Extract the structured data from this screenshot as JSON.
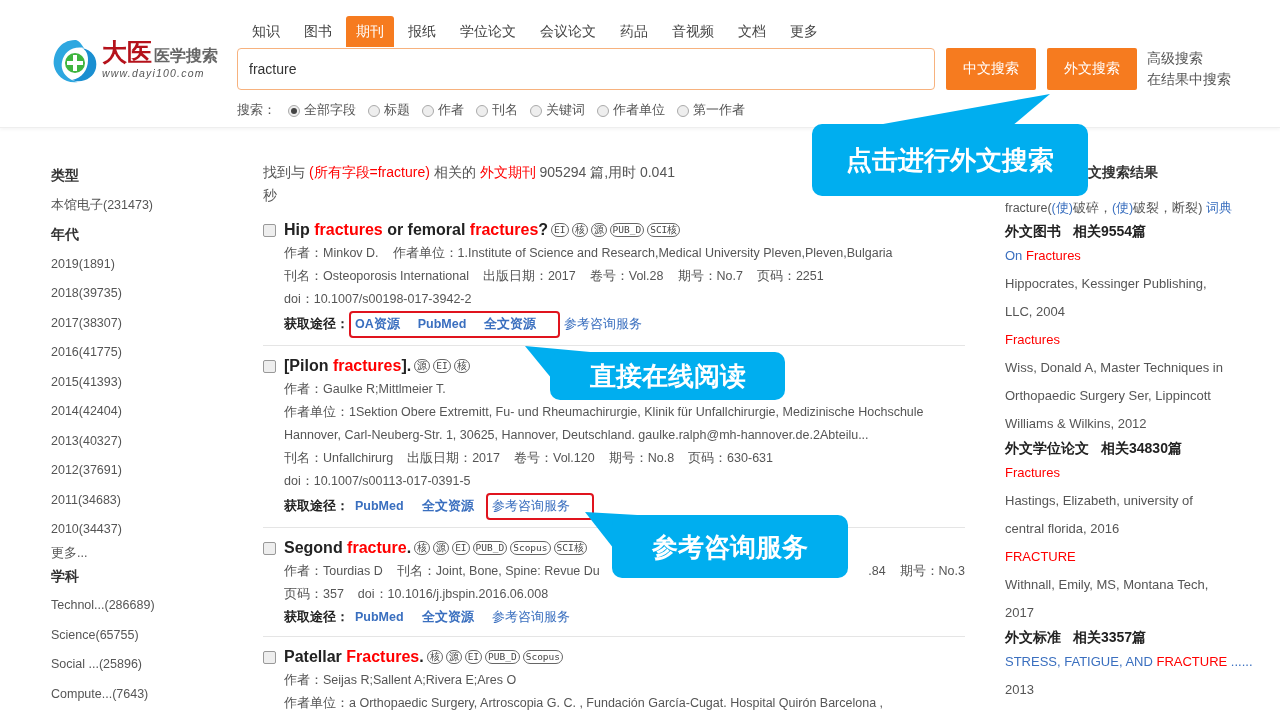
{
  "logo": {
    "brand": "大医",
    "subtitle": "医学搜索",
    "url": "www.dayi100.com"
  },
  "tabs": [
    {
      "label": "知识",
      "selected": false
    },
    {
      "label": "图书",
      "selected": false
    },
    {
      "label": "期刊",
      "selected": true
    },
    {
      "label": "报纸",
      "selected": false
    },
    {
      "label": "学位论文",
      "selected": false
    },
    {
      "label": "会议论文",
      "selected": false
    },
    {
      "label": "药品",
      "selected": false
    },
    {
      "label": "音视频",
      "selected": false
    },
    {
      "label": "文档",
      "selected": false
    },
    {
      "label": "更多",
      "selected": false
    }
  ],
  "search": {
    "value": "fracture",
    "buttons": [
      "中文搜索",
      "外文搜索"
    ],
    "links": [
      "高级搜索",
      "在结果中搜索"
    ]
  },
  "scope": {
    "label": "搜索：",
    "options": [
      {
        "label": "全部字段",
        "selected": true
      },
      {
        "label": "标题",
        "selected": false
      },
      {
        "label": "作者",
        "selected": false
      },
      {
        "label": "刊名",
        "selected": false
      },
      {
        "label": "关键词",
        "selected": false
      },
      {
        "label": "作者单位",
        "selected": false
      },
      {
        "label": "第一作者",
        "selected": false
      }
    ]
  },
  "sidebar": {
    "groups": [
      {
        "heading": "类型",
        "items": [
          "本馆电子(231473)"
        ]
      },
      {
        "heading": "年代",
        "items": [
          "2019(1891)",
          "2018(39735)",
          "2017(38307)",
          "2016(41775)",
          "2015(41393)",
          "2014(42404)",
          "2013(40327)",
          "2012(37691)",
          "2011(34683)",
          "2010(34437)"
        ],
        "more": "更多..."
      },
      {
        "heading": "学科",
        "items": [
          "Technol...(286689)",
          "Science(65755)",
          "Social ...(25896)",
          "Compute...(7643)"
        ]
      }
    ]
  },
  "summary": [
    {
      "text": "找到与 "
    },
    {
      "text": "(所有字段=fracture)",
      "hit": true
    },
    {
      "text": " 相关的 "
    },
    {
      "text": "外文期刊",
      "hit": true
    },
    {
      "text": " 905294 篇,用时 0.041 秒"
    }
  ],
  "results": [
    {
      "checked": false,
      "title": [
        {
          "text": "Hip "
        },
        {
          "text": "fractures",
          "hit": true
        },
        {
          "text": " or femoral "
        },
        {
          "text": "fractures",
          "hit": true
        },
        {
          "text": "?"
        }
      ],
      "tags": [
        "EI",
        "核",
        "源",
        "PUB_D",
        "SCI核"
      ],
      "lines": [
        {
          "fields": [
            "作者：Minkov D.",
            "作者单位：1.Institute of Science and Research,Medical University Pleven,Pleven,Bulgaria"
          ]
        },
        {
          "fields": [
            "刊名：Osteoporosis International",
            "出版日期：2017",
            "卷号：Vol.28",
            "期号：No.7",
            "页码：2251"
          ]
        },
        {
          "fields": [
            "doi：10.1007/s00198-017-3942-2"
          ]
        }
      ],
      "access_label": "获取途径：",
      "links": [
        {
          "text": "OA资源",
          "bold": true,
          "outlined": true
        },
        {
          "text": "PubMed",
          "bold": true,
          "outlined": true
        },
        {
          "text": "全文资源",
          "bold": true,
          "outlined": true
        },
        {
          "text": "参考咨询服务",
          "bold": false,
          "outlined": false
        }
      ]
    },
    {
      "checked": false,
      "title": [
        {
          "text": "[Pilon "
        },
        {
          "text": "fractures",
          "hit": true
        },
        {
          "text": "]."
        }
      ],
      "tags": [
        "源",
        "EI",
        "核"
      ],
      "lines": [
        {
          "fields": [
            "作者：Gaulke R;Mittlmeier T."
          ]
        },
        {
          "fields": [
            "作者单位：1Sektion Obere Extremitt, Fu- und Rheumachirurgie, Klinik für Unfallchirurgie, Medizinische Hochschule Hannover, Carl-Neuberg-Str. 1, 30625, Hannover, Deutschland. gaulke.ralph@mh-hannover.de.2Abteilu..."
          ]
        },
        {
          "fields": [
            "刊名：Unfallchirurg",
            "出版日期：2017",
            "卷号：Vol.120",
            "期号：No.8",
            "页码：630-631"
          ]
        },
        {
          "fields": [
            "doi：10.1007/s00113-017-0391-5"
          ]
        }
      ],
      "access_label": "获取途径：",
      "links": [
        {
          "text": "PubMed",
          "bold": true,
          "outlined": false
        },
        {
          "text": "全文资源",
          "bold": true,
          "outlined": false
        },
        {
          "text": "参考咨询服务",
          "bold": false,
          "outlined": true
        }
      ]
    },
    {
      "checked": false,
      "title": [
        {
          "text": "Segond "
        },
        {
          "text": "fracture",
          "hit": true
        },
        {
          "text": "."
        }
      ],
      "tags": [
        "核",
        "源",
        "EI",
        "PUB_D",
        "Scopus",
        "SCI核"
      ],
      "lines": [
        {
          "fields": [
            "作者：Tourdias D",
            "刊名：Joint, Bone, Spine: Revue Du"
          ],
          "right": [
            ".84",
            "期号：No.3"
          ]
        },
        {
          "fields": [
            "页码：357",
            "doi：10.1016/j.jbspin.2016.06.008"
          ]
        }
      ],
      "access_label": "获取途径：",
      "links": [
        {
          "text": "PubMed",
          "bold": true,
          "outlined": false
        },
        {
          "text": "全文资源",
          "bold": true,
          "outlined": false
        },
        {
          "text": "参考咨询服务",
          "bold": false,
          "outlined": false
        }
      ]
    },
    {
      "checked": false,
      "title": [
        {
          "text": "Patellar "
        },
        {
          "text": "Fractures",
          "hit": true
        },
        {
          "text": "."
        }
      ],
      "tags": [
        "核",
        "源",
        "EI",
        "PUB_D",
        "Scopus"
      ],
      "lines": [
        {
          "fields": [
            "作者：Seijas R;Sallent A;Rivera E;Ares O"
          ]
        },
        {
          "fields": [
            "作者单位：a Orthopaedic Surgery, Artroscopia G. C. , Fundación García-Cugat. Hospital Quirón Barcelona ,"
          ]
        }
      ]
    }
  ],
  "related": {
    "heading": "文搜索结果",
    "dictionary": [
      {
        "text": "fracture(",
        "link": false
      },
      {
        "text": "(使)",
        "link": true
      },
      {
        "text": "破碎，",
        "link": false
      },
      {
        "text": "(使)",
        "link": true
      },
      {
        "text": "破裂，断裂)",
        "link": false
      },
      {
        "text": " 词典",
        "link": true
      }
    ],
    "sections": [
      {
        "heading": "外文图书",
        "count": "相关9554篇",
        "items": [
          {
            "title": [
              {
                "text": "On "
              },
              {
                "text": "Fractures",
                "hit": true
              }
            ],
            "description": "Hippocrates, Kessinger Publishing, LLC, 2004"
          },
          {
            "title": [
              {
                "text": "Fractures",
                "hit": true
              }
            ],
            "description": "Wiss, Donald A, Master Techniques in Orthopaedic Surgery Ser, Lippincott Williams & Wilkins, 2012"
          }
        ]
      },
      {
        "heading": "外文学位论文",
        "count": "相关34830篇",
        "items": [
          {
            "title": [
              {
                "text": "Fractures",
                "hit": true
              }
            ],
            "description": "Hastings, Elizabeth, university of central florida, 2016"
          },
          {
            "title": [
              {
                "text": "FRACTURE",
                "hit": true
              }
            ],
            "description": "Withnall, Emily, MS, Montana Tech, 2017"
          }
        ]
      },
      {
        "heading": "外文标准",
        "count": "相关3357篇",
        "items": [
          {
            "title": [
              {
                "text": "STRESS, FATIGUE, AND "
              },
              {
                "text": "FRACTURE",
                "hit": true
              },
              {
                "text": " ......"
              }
            ],
            "description": "2013"
          }
        ]
      }
    ]
  },
  "callouts": [
    {
      "text": "点击进行外文搜索"
    },
    {
      "text": "直接在线阅读"
    },
    {
      "text": "参考咨询服务"
    }
  ]
}
